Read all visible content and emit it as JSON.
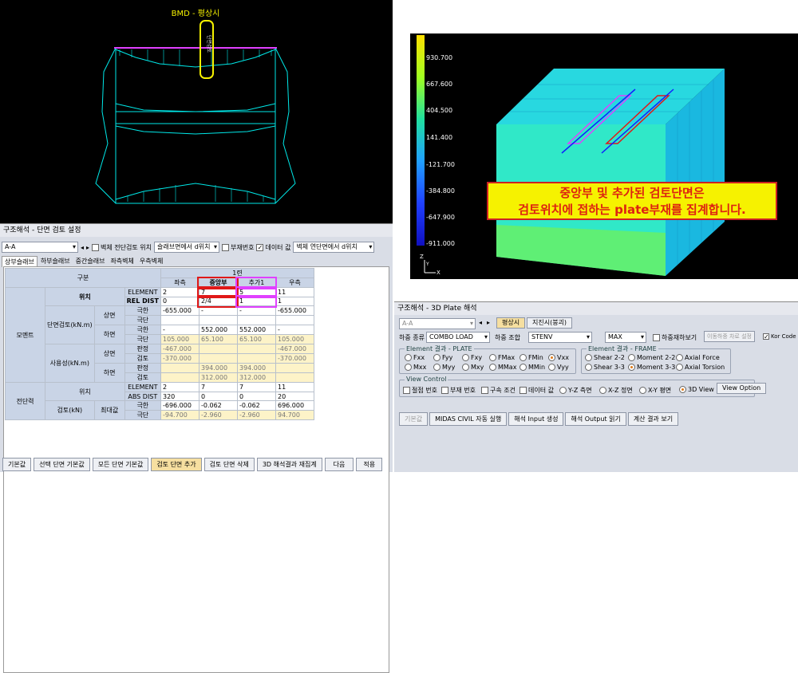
{
  "left": {
    "bmd_title": "BMD - 평상시",
    "bmd_vlabel": "단면검토",
    "panel_title": "구조해석 - 단면 검토 설정",
    "section_select": "A-A",
    "chk_shear_pos": "벽체 전단검토 위치",
    "shear_pos_select": "슬래브면에서 d위치",
    "chk_member_no": "부재번호",
    "chk_data_value": "데이터 값",
    "wall_shear_select": "벽체 연단면에서 d위치",
    "tabs": [
      "상부슬래브",
      "하부슬래브",
      "중간슬래브",
      "좌측벽체",
      "우측벽체"
    ],
    "grid": {
      "col_top": "1련",
      "col_heads": [
        "좌측",
        "중앙부",
        "추가1",
        "우측"
      ],
      "gubun": "구분",
      "moment": "모멘트",
      "shear": "전단력",
      "position": "위치",
      "element": "ELEMENT",
      "rel_dist": "REL DIST",
      "abs_dist": "ABS DIST",
      "sec_check": "단면검토(kN.m)",
      "service": "사용성(kN.m)",
      "check_kn": "검토(kN)",
      "top": "상면",
      "bottom": "하면",
      "maxval": "최대값",
      "ext": "극한",
      "end": "극단",
      "judge": "판정",
      "check": "검토",
      "el_vals": [
        "2",
        "7",
        "5",
        "11"
      ],
      "rd_vals": [
        "0",
        "2/4",
        "1",
        "1"
      ],
      "m_top_ext": [
        "-655.000",
        "-",
        "-",
        "-655.000"
      ],
      "m_top_end": [
        "",
        "",
        "",
        ""
      ],
      "m_bot_ext": [
        "-",
        "552.000",
        "552.000",
        "-"
      ],
      "m_bot_end": [
        "105.000",
        "65.100",
        "65.100",
        "105.000"
      ],
      "s_top_judge": [
        "-467.000",
        "",
        "",
        "-467.000"
      ],
      "s_top_check": [
        "-370.000",
        "",
        "",
        "-370.000"
      ],
      "s_bot_judge": [
        "",
        "394.000",
        "394.000",
        ""
      ],
      "s_bot_check": [
        "",
        "312.000",
        "312.000",
        ""
      ],
      "sh_el": [
        "2",
        "7",
        "7",
        "11"
      ],
      "sh_abs": [
        "320",
        "0",
        "0",
        "20"
      ],
      "sh_ext": [
        "-696.000",
        "-0.062",
        "-0.062",
        "696.000"
      ],
      "sh_end": [
        "-94.700",
        "-2.960",
        "-2.960",
        "94.700"
      ]
    },
    "buttons": [
      "기본값",
      "선택 단면 기본값",
      "모든 단면 기본값",
      "검토 단면 추가",
      "검토 단면 삭제",
      "3D 해석결과 재집계",
      "다음",
      "적용"
    ]
  },
  "right": {
    "legend": [
      "930.700",
      "667.600",
      "404.500",
      "141.400",
      "-121.700",
      "-384.800",
      "-647.900",
      "-911.000"
    ],
    "axis_z": "Z",
    "axis_x": "X",
    "axis_y": "Y",
    "banner_line1": "중앙부 및 추가된 검토단면은",
    "banner_line2": "검토위치에 접하는 plate부재를 집계합니다.",
    "panel_title": "구조해석 - 3D Plate 해석",
    "section_select": "A-A",
    "btn_normal": "평상시",
    "btn_quake": "지진시(붕괴)",
    "load_kind_label": "하중 종류",
    "load_kind": "COMBO LOAD",
    "load_comb_label": "하중 조합",
    "load_comb": "STENV",
    "max_select": "MAX",
    "chk_reload": "하중재하보기",
    "btn_move": "이동하중 차로 설정",
    "chk_kor": "Kor Code",
    "plate_group": "Element 결과 - PLATE",
    "plate_items": [
      "Fxx",
      "Fyy",
      "Fxy",
      "FMax",
      "FMin",
      "Vxx",
      "Mxx",
      "Myy",
      "Mxy",
      "MMax",
      "MMin",
      "Vyy"
    ],
    "frame_group": "Element 결과 - FRAME",
    "frame_items": [
      "Shear 2-2",
      "Moment 2-2",
      "Axial Force",
      "Shear 3-3",
      "Moment 3-3",
      "Axial Torsion"
    ],
    "view_group": "View Control",
    "view_items": [
      "절점 번호",
      "부재 번호",
      "구속 조건",
      "데이터 값",
      "Y-Z 측면",
      "X-Z 정면",
      "X-Y 평면",
      "3D View"
    ],
    "btn_view_option": "View Option",
    "bottom_buttons": [
      "기본값",
      "MIDAS CIVIL 자동 실행",
      "해석 Input 생성",
      "해석 Output 읽기",
      "계산 결과 보기"
    ]
  },
  "colors": {
    "accent": "#e01818",
    "magenta": "#e040ff",
    "cyan": "#00e0e0",
    "banner": "#f6f200"
  }
}
